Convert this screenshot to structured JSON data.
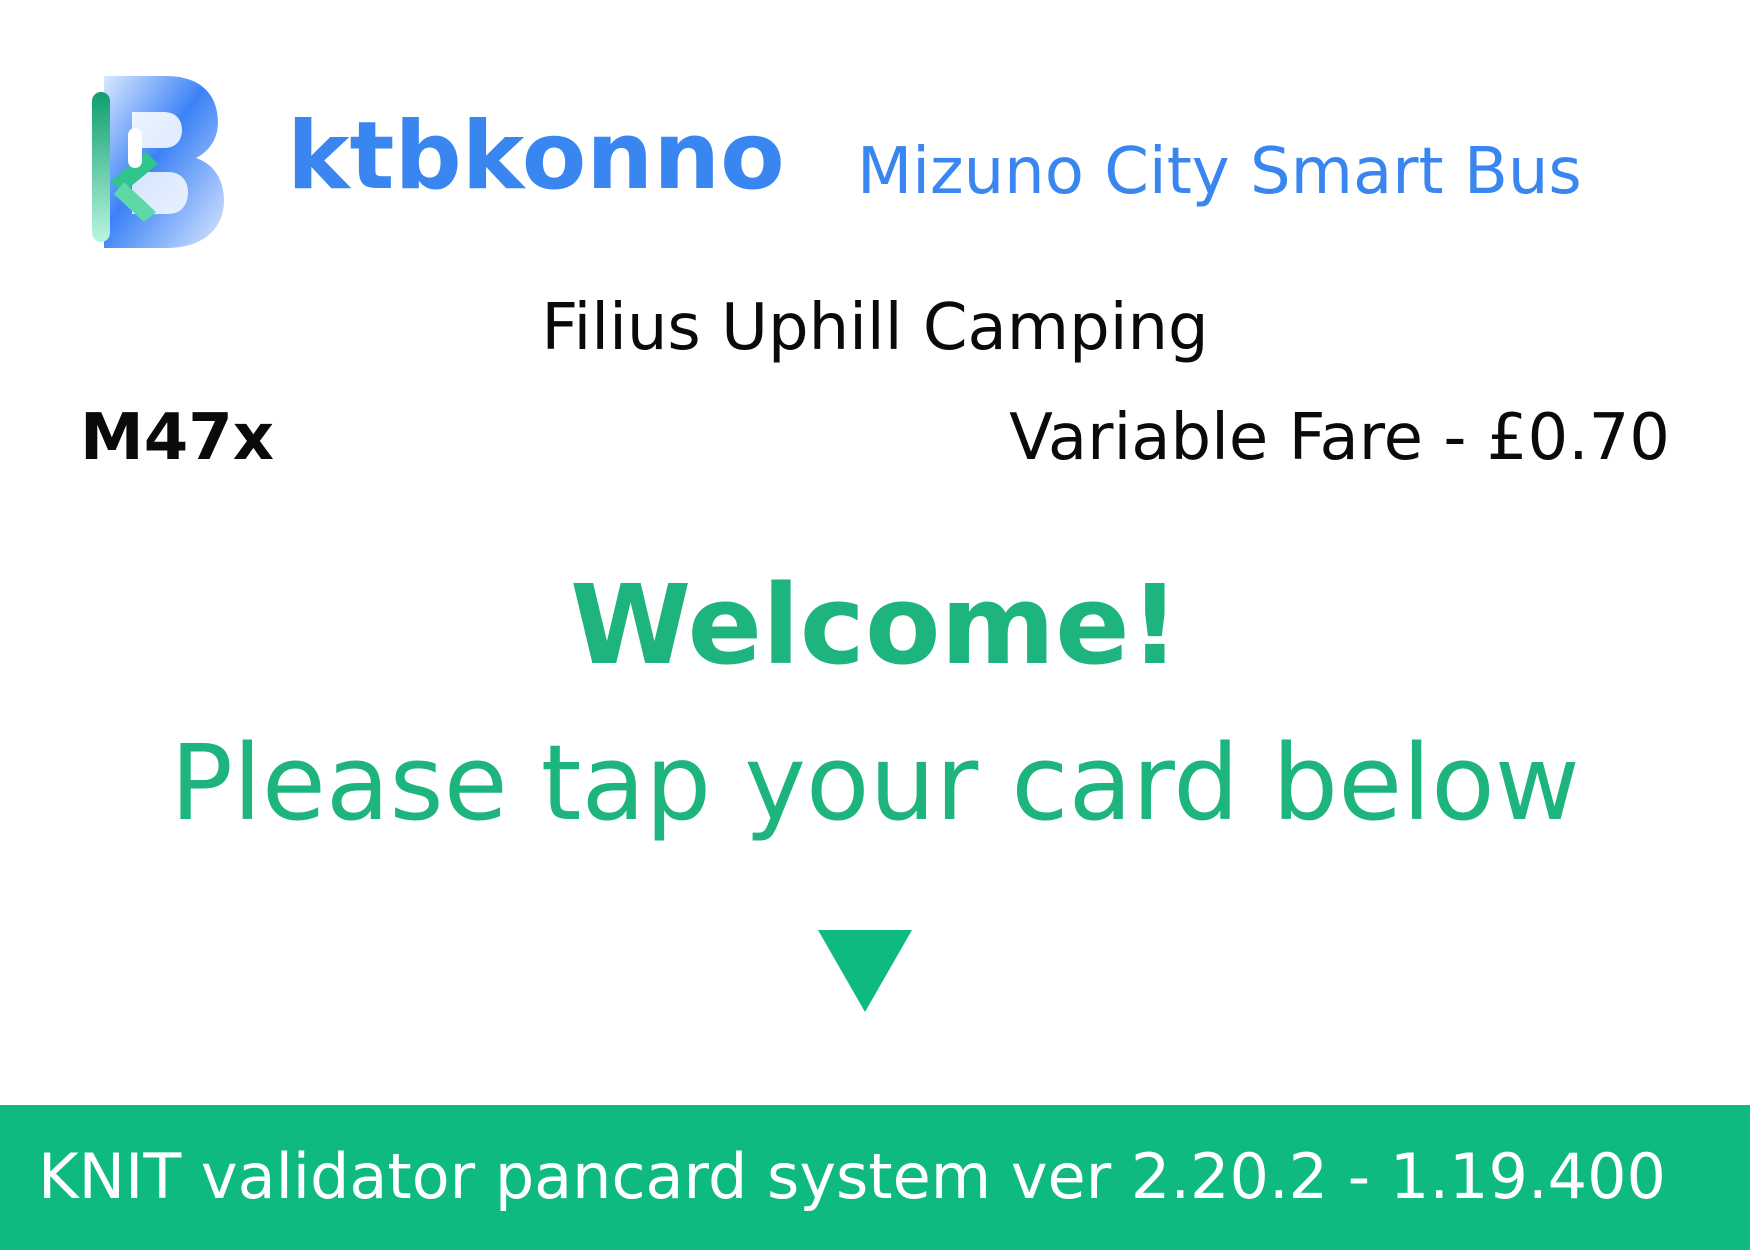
{
  "header": {
    "logo_icon": "ktbkonno-b-logo-icon",
    "brand_name": "ktbkonno",
    "service_name": "Mizuno City Smart Bus"
  },
  "stop": {
    "name": "Filius Uphill Camping"
  },
  "trip": {
    "route": "M47x",
    "fare": "Variable Fare - £0.70"
  },
  "message": {
    "welcome": "Welcome!",
    "instruction": "Please tap your card below",
    "arrow_icon": "down-triangle-icon"
  },
  "footer": {
    "system_text": "KNIT validator pancard system ver 2.20.2 - 1.19.400"
  },
  "colors": {
    "brand_blue": "#3a86f0",
    "accent_green": "#1db47d",
    "footer_green": "#0fba81",
    "text": "#0a0a0a",
    "background": "#ffffff"
  }
}
